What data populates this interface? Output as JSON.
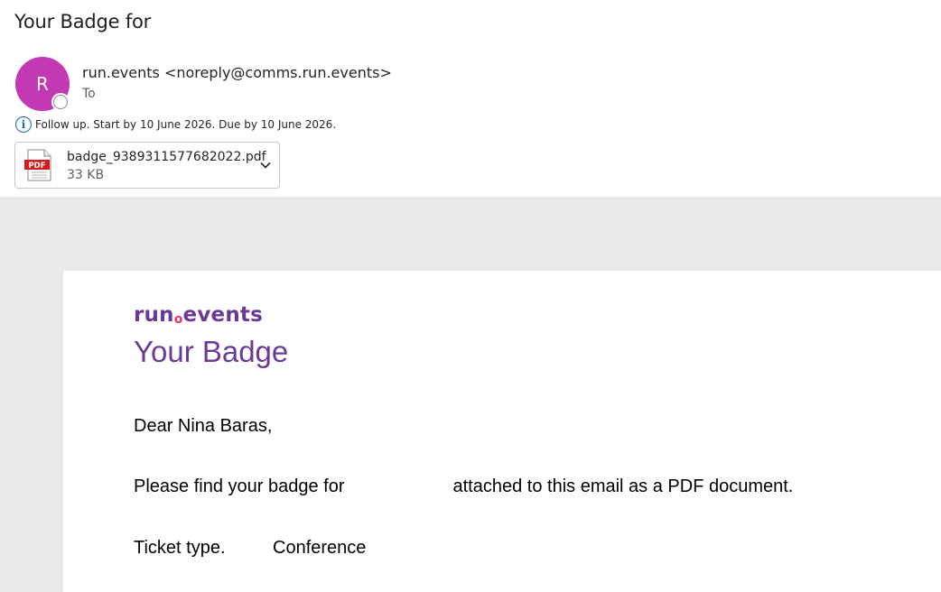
{
  "email": {
    "subject": "Your Badge for",
    "sender_initial": "R",
    "sender": "run.events <noreply@comms.run.events>",
    "to_label": "To",
    "followup": "Follow up.  Start by 10 June 2026.  Due by 10 June 2026.",
    "attachment": {
      "filename": "badge_9389311577682022.pdf",
      "size": "33 KB",
      "type_label": "PDF"
    }
  },
  "body": {
    "logo_part1": "run",
    "logo_dot": "o",
    "logo_part2": "events",
    "title": "Your Badge",
    "greeting": "Dear Nina Baras,",
    "para_prefix": "Please find your badge for",
    "para_suffix": "attached to this email as a PDF document.",
    "ticket_label": "Ticket type.",
    "ticket_value": "Conference"
  },
  "colors": {
    "avatar": "#c239b3",
    "brand_purple": "#6b3a96",
    "logo_dot": "#e8336d",
    "info_blue": "#0f6cbd",
    "pdf_red": "#d7191e"
  }
}
